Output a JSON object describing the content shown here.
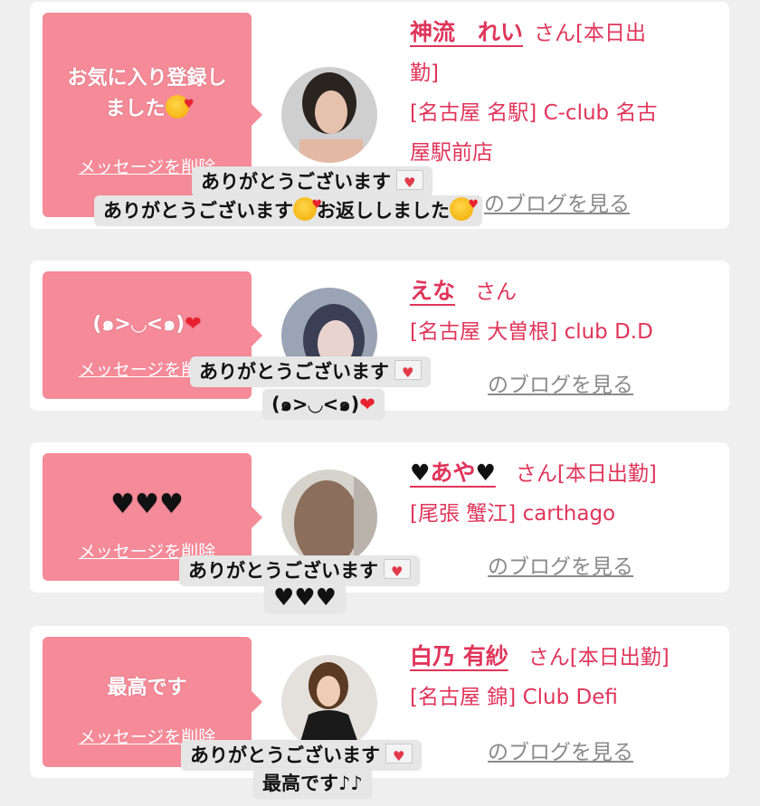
{
  "cards": [
    {
      "bubble_line1": "お気に入り登録し",
      "bubble_line2": "ました",
      "delete_label": "メッセージを削除",
      "name": "神流　れい",
      "san": "さん[本日出",
      "san2": "勤]",
      "area": "[名古屋 名駅] C-club 名古",
      "area2": "屋駅前店",
      "blog": "のブログを見る",
      "toast1": "ありがとうございます",
      "toast2a": "ありがとうございます",
      "toast2b": "お返ししました"
    },
    {
      "bubble_line1": "(๑>◡<๑)",
      "delete_label": "メッセージを削除",
      "name": "えな",
      "san": "さん",
      "area": "[名古屋 大曽根] club D.D",
      "blog": "のブログを見る",
      "toast1": "ありがとうございます",
      "toast2": "(๑>◡<๑)"
    },
    {
      "bubble_line1": "♥♥♥",
      "delete_label": "メッセージを削除",
      "name": "あや",
      "san": "さん[本日出勤]",
      "area": "[尾張 蟹江] carthago",
      "blog": "のブログを見る",
      "toast1": "ありがとうございます",
      "toast2": "♥♥♥"
    },
    {
      "bubble_line1": "最高です",
      "delete_label": "メッセージを削除",
      "name": "白乃 有紗",
      "san": "さん[本日出勤]",
      "area": "[名古屋 錦] Club Defi",
      "blog": "のブログを見る",
      "toast1": "ありがとうございます",
      "toast2": "最高です♪♪"
    }
  ],
  "colors": {
    "bubble": "#f58a98",
    "accent": "#e0355b",
    "background": "#efefef"
  }
}
